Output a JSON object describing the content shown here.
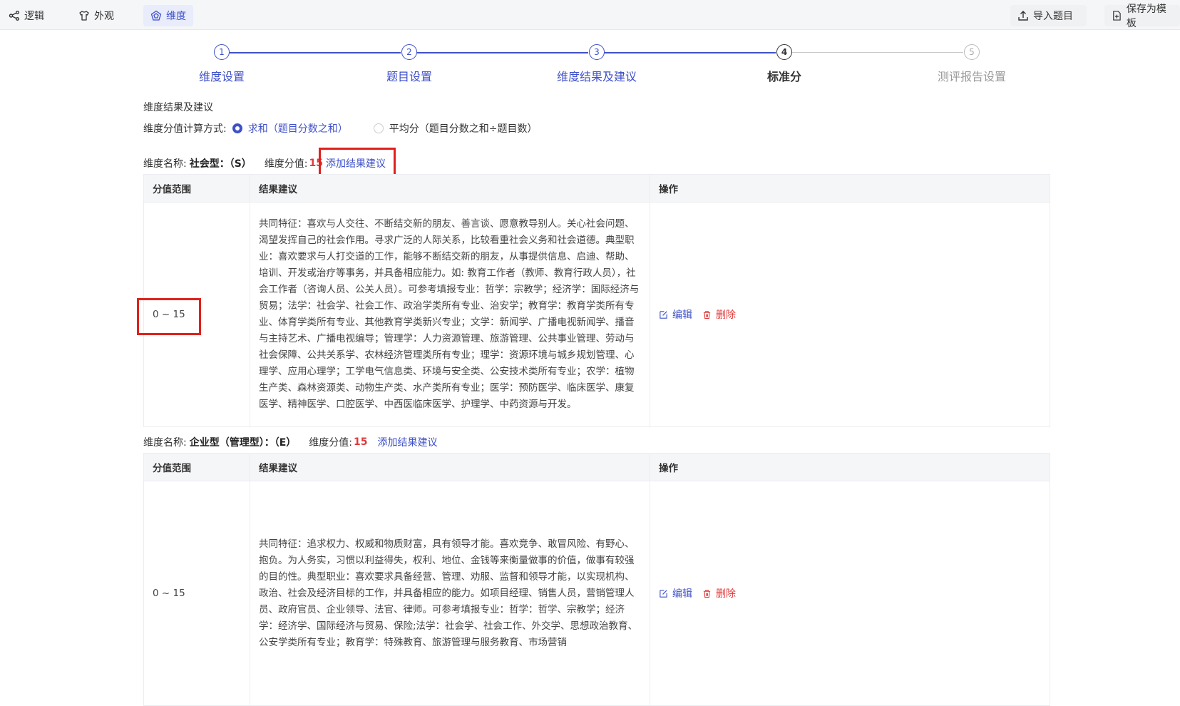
{
  "toolbar": {
    "logic": "逻辑",
    "appearance": "外观",
    "dimension": "维度",
    "import": "导入题目",
    "save_template": "保存为模板"
  },
  "steps": [
    {
      "num": "1",
      "label": "维度设置"
    },
    {
      "num": "2",
      "label": "题目设置"
    },
    {
      "num": "3",
      "label": "维度结果及建议"
    },
    {
      "num": "4",
      "label": "标准分"
    },
    {
      "num": "5",
      "label": "测评报告设置"
    }
  ],
  "section_title": "维度结果及建议",
  "calc": {
    "label": "维度分值计算方式:",
    "option_sum": "求和（题目分数之和）",
    "option_avg": "平均分（题目分数之和÷题目数）",
    "selected": "sum"
  },
  "table_headers": {
    "range": "分值范围",
    "advice": "结果建议",
    "op": "操作"
  },
  "actions": {
    "edit": "编辑",
    "delete": "删除"
  },
  "dimensions": [
    {
      "name_label": "维度名称:",
      "name": "社会型：（S）",
      "score_label": "维度分值:",
      "score": "15",
      "add_label": "添加结果建议",
      "rows": [
        {
          "range": "0 ~ 15",
          "advice": "共同特征：喜欢与人交往、不断结交新的朋友、善言谈、愿意教导别人。关心社会问题、渴望发挥自己的社会作用。寻求广泛的人际关系，比较看重社会义务和社会道德。典型职业：喜欢要求与人打交道的工作，能够不断结交新的朋友，从事提供信息、启迪、帮助、培训、开发或治疗等事务，并具备相应能力。如: 教育工作者（教师、教育行政人员），社会工作者（咨询人员、公关人员）。可参考填报专业：哲学：宗教学；经济学：国际经济与贸易；法学：社会学、社会工作、政治学类所有专业、治安学；教育学：教育学类所有专业、体育学类所有专业、其他教育学类新兴专业；文学：新闻学、广播电视新闻学、播音与主持艺术、广播电视编导；管理学：人力资源管理、旅游管理、公共事业管理、劳动与社会保障、公共关系学、农林经济管理类所有专业；理学：资源环境与城乡规划管理、心理学、应用心理学；工学电气信息类、环境与安全类、公安技术类所有专业；农学：植物生产类、森林资源类、动物生产类、水产类所有专业；医学：预防医学、临床医学、康复医学、精神医学、口腔医学、中西医临床医学、护理学、中药资源与开发。"
        }
      ]
    },
    {
      "name_label": "维度名称:",
      "name": "企业型（管理型）：（E）",
      "score_label": "维度分值:",
      "score": "15",
      "add_label": "添加结果建议",
      "rows": [
        {
          "range": "0 ~ 15",
          "advice": "共同特征：追求权力、权威和物质财富，具有领导才能。喜欢竞争、敢冒风险、有野心、抱负。为人务实，习惯以利益得失，权利、地位、金钱等来衡量做事的价值，做事有较强的目的性。典型职业：喜欢要求具备经营、管理、劝服、监督和领导才能，以实现机构、政治、社会及经济目标的工作，并具备相应的能力。如项目经理、销售人员，营销管理人员、政府官员、企业领导、法官、律师。可参考填报专业：哲学：哲学、宗教学；经济学：经济学、国际经济与贸易、保险;法学：社会学、社会工作、外交学、思想政治教育、公安学类所有专业；教育学：特殊教育、旅游管理与服务教育、市场营销"
        }
      ]
    }
  ]
}
